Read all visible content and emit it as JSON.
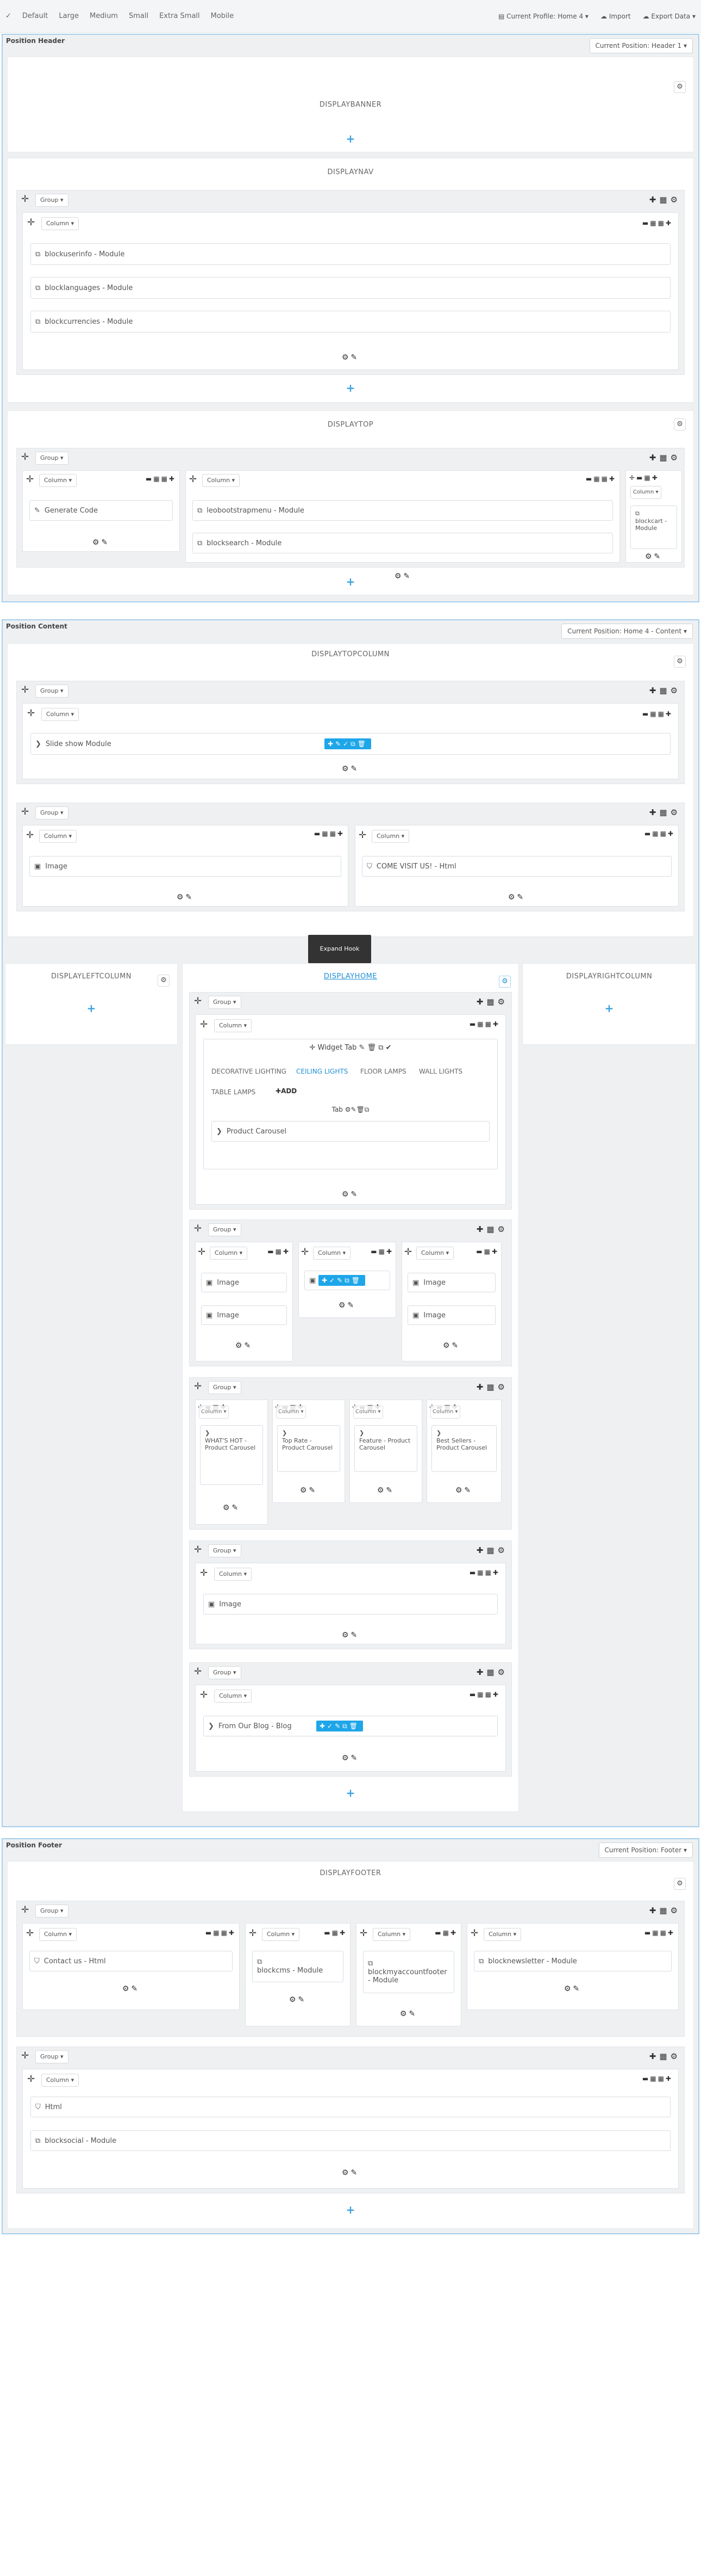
{
  "toolbar": {
    "check": "✓",
    "sizes": [
      "Default",
      "Large",
      "Medium",
      "Small",
      "Extra Small",
      "Mobile"
    ],
    "profile": "Current Profile: Home 4 ▾",
    "import": "Import",
    "export": "Export Data ▾"
  },
  "ui": {
    "group": "Group ▾",
    "column": "Column ▾",
    "add": "+",
    "gear": "⚙"
  },
  "header": {
    "title": "Position Header",
    "select": "Current Position: Header 1 ▾",
    "banner": "DISPLAYBANNER",
    "nav": "DISPLAYNAV",
    "nav_modules": [
      "blockuserinfo - Module",
      "blocklanguages - Module",
      "blockcurrencies - Module"
    ],
    "top": "DISPLAYTOP",
    "top_col1": "Generate Code",
    "top_col2": [
      "leobootstrapmenu - Module",
      "blocksearch - Module"
    ],
    "top_col3": "blockcart - Module"
  },
  "content": {
    "title": "Position Content",
    "select": "Current Position: Home 4 - Content ▾",
    "topcolumn": "DISPLAYTOPCOLUMN",
    "slideshow": "Slide show Module",
    "image": "Image",
    "visit": "COME VISIT US! - Html",
    "expand": "Expand Hook",
    "left": "DISPLAYLEFTCOLUMN",
    "home": "DISPLAYHOME",
    "right": "DISPLAYRIGHTCOLUMN",
    "widget_tab": "Widget Tab",
    "tabs": [
      "DECORATIVE LIGHTING",
      "CEILING LIGHTS",
      "FLOOR LAMPS",
      "WALL LIGHTS"
    ],
    "tab_table": "TABLE LAMPS",
    "tab_add": "ADD",
    "tab_label": "Tab",
    "carousel": "Product Carousel",
    "carousels": [
      "WHAT'S HOT - Product Carousel",
      "Top Rate - Product Carousel",
      "Feature - Product Carousel",
      "Best Sellers - Product Carousel"
    ],
    "blog": "From Our Blog - Blog"
  },
  "footer": {
    "title": "Position Footer",
    "select": "Current Position: Footer ▾",
    "hook": "DISPLAYFOOTER",
    "contact": "Contact us - Html",
    "cms": "blockcms - Module",
    "myaccount": "blockmyaccountfooter - Module",
    "newsletter": "blocknewsletter - Module",
    "html": "Html",
    "social": "blocksocial - Module"
  },
  "colors": {
    "accent": "#1ea6e9",
    "border": "#a6d0ed"
  }
}
